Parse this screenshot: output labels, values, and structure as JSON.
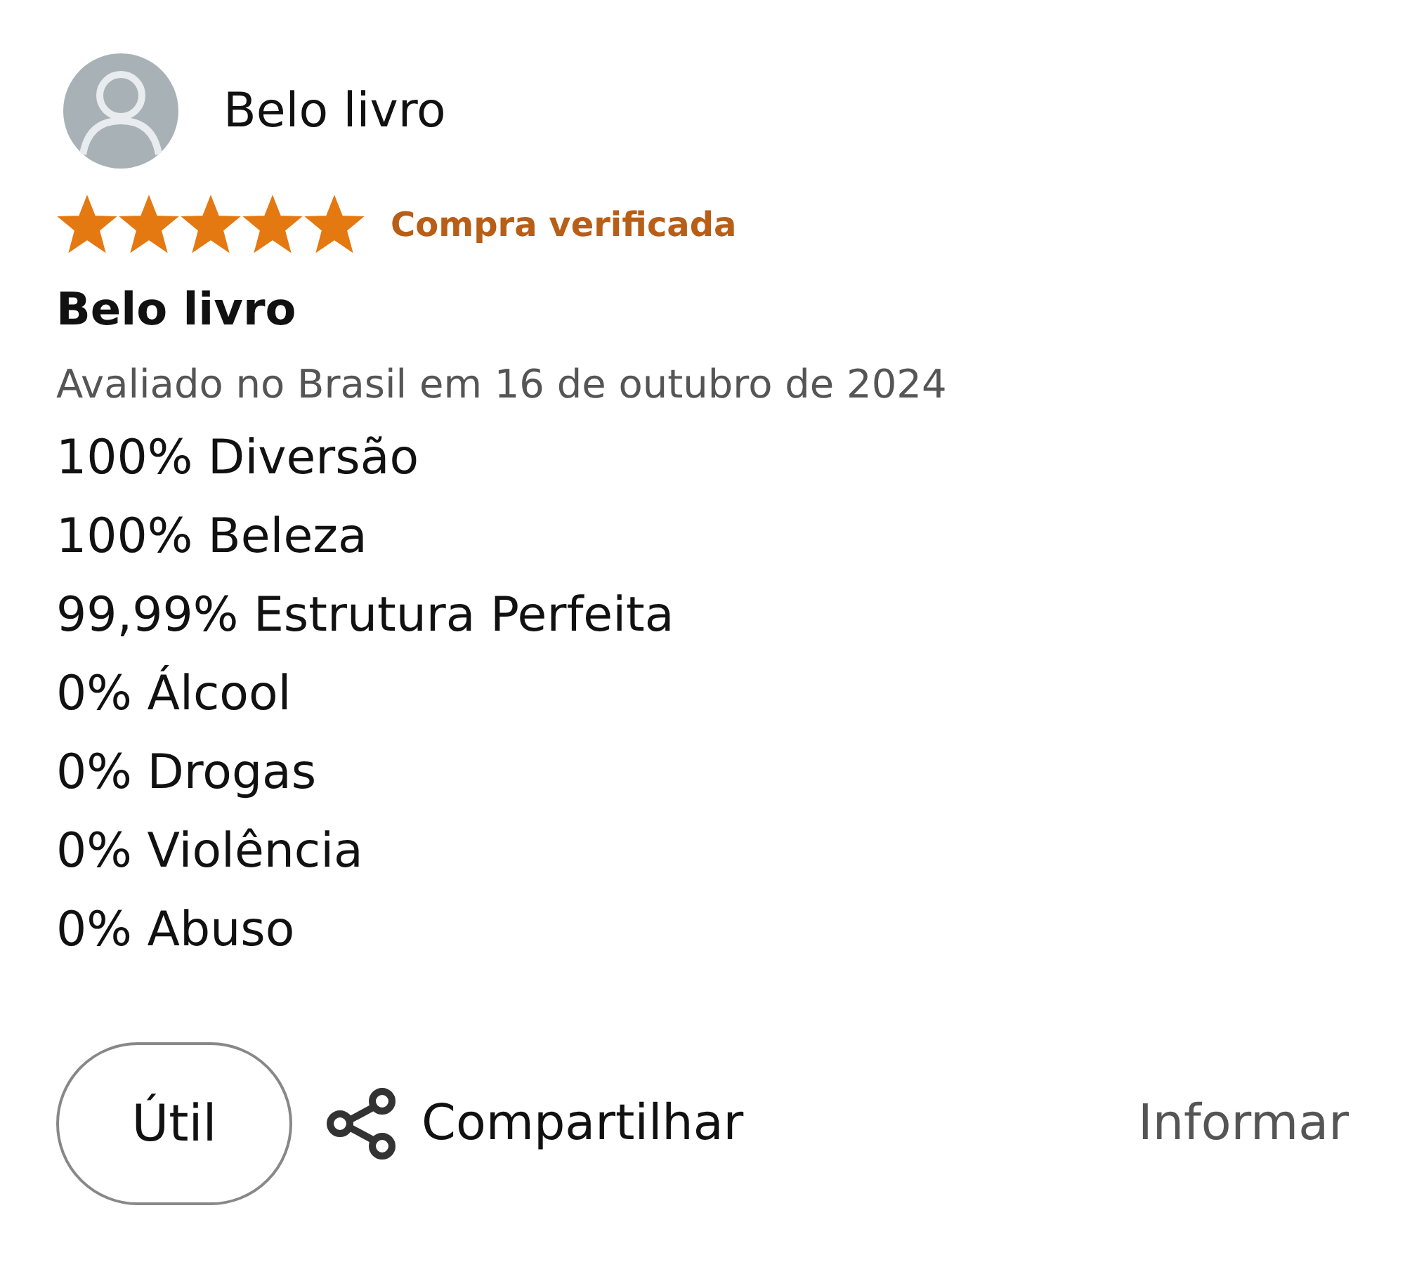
{
  "review": {
    "author": "Belo livro",
    "stars": 5,
    "badge": "Compra verificada",
    "title": "Belo livro",
    "date": "Avaliado no Brasil em 16 de outubro de 2024",
    "lines": [
      "100% Diversão",
      "100% Beleza",
      "99,99% Estrutura Perfeita",
      "0% Álcool",
      "0% Drogas",
      "0% Violência",
      "0% Abuso"
    ]
  },
  "actions": {
    "helpful": "Útil",
    "share": "Compartilhar",
    "report": "Informar"
  }
}
